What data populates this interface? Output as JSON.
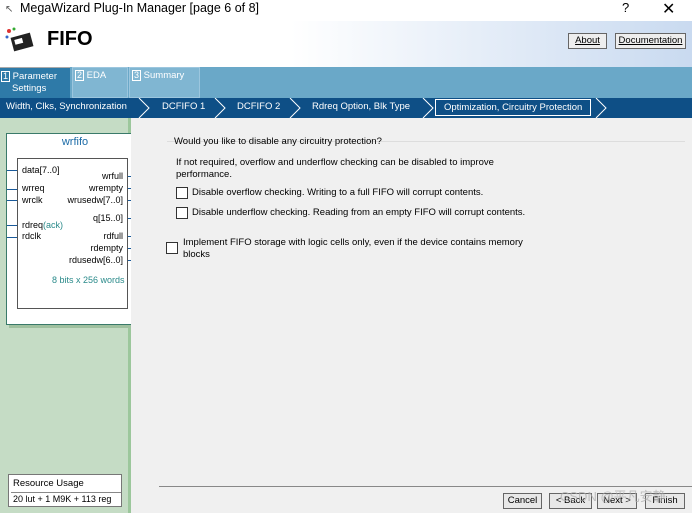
{
  "window": {
    "title": "MegaWizard Plug-In Manager [page 6 of 8]",
    "help": "?",
    "close": "✕"
  },
  "header": {
    "title": "FIFO",
    "about": "About",
    "documentation": "Documentation"
  },
  "tabs": [
    {
      "num": "1",
      "label1": "Parameter",
      "label2": "Settings"
    },
    {
      "num": "2",
      "label1": "EDA"
    },
    {
      "num": "3",
      "label1": "Summary"
    }
  ],
  "breadcrumbs": [
    "Width, Clks, Synchronization",
    "DCFIFO 1",
    "DCFIFO 2",
    "Rdreq Option, Blk Type",
    "Optimization, Circuitry Protection"
  ],
  "symbol": {
    "name": "wrfifo",
    "pins": {
      "data": "data[7..0]",
      "wrfull": "wrfull",
      "wrreq": "wrreq",
      "wrempty": "wrempty",
      "wrclk": "wrclk",
      "wrusedw": "wrusedw[7..0]",
      "q": "q[15..0]",
      "rdreq": "rdreq",
      "ack": "(ack)",
      "rdfull": "rdfull",
      "rdclk": "rdclk",
      "rdempty": "rdempty",
      "rdusedw": "rdusedw[6..0]"
    },
    "size": "8 bits x 256 words"
  },
  "resource": {
    "label": "Resource Usage",
    "value": "20 lut + 1 M9K + 113 reg"
  },
  "main": {
    "question": "Would you like to disable any circuitry protection?",
    "desc1": "If not required, overflow and underflow checking can be disabled to improve",
    "desc2": "performance.",
    "overflow": "Disable overflow checking. Writing to a full FIFO will corrupt contents.",
    "underflow": "Disable underflow checking. Reading from an empty FIFO will corrupt contents.",
    "logic1": "Implement FIFO storage with logic cells only, even if the device contains memory",
    "logic2": "blocks"
  },
  "buttons": {
    "cancel": "Cancel",
    "back": "< Back",
    "next": "Next >",
    "finish": "Finish"
  },
  "watermark": "CSDN @平凡安静",
  "colors": {
    "breadcrumb_bg": "#0e4f86",
    "tab_bg": "#6aa8c8",
    "left_panel": "#c5dcc5",
    "main_bg": "#f0f0f0"
  }
}
